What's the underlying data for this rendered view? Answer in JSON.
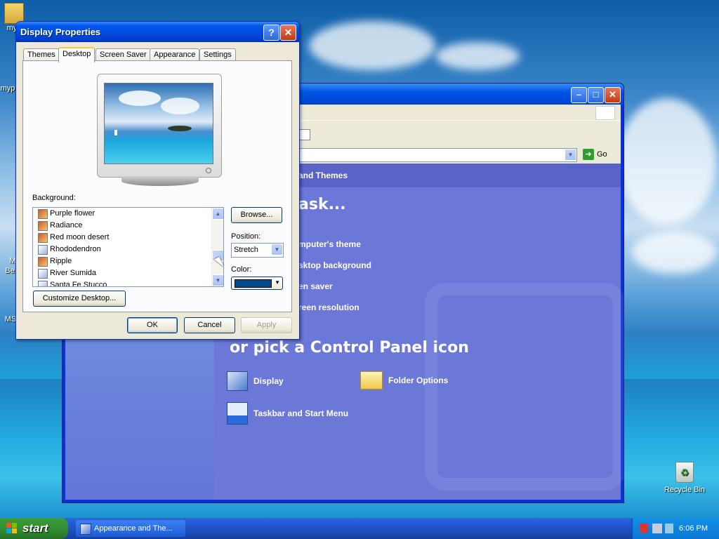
{
  "desktop": {
    "icons": [
      {
        "label": "myp"
      },
      {
        "label": "myp"
      },
      {
        "label": "M"
      },
      {
        "label": "Be"
      },
      {
        "label": "MS"
      },
      {
        "label": "Recycle Bin"
      }
    ]
  },
  "control_panel": {
    "go_label": "Go",
    "breadcrumb": "and Themes",
    "task_heading": "ask...",
    "tasks": [
      "mputer's theme",
      "sktop background",
      "en saver",
      "reen resolution"
    ],
    "icon_heading": "or pick a Control Panel icon",
    "icons": [
      {
        "label": "Display",
        "icon": "display-icon"
      },
      {
        "label": "Folder Options",
        "icon": "folder-options-icon"
      },
      {
        "label": "Taskbar and Start Menu",
        "icon": "taskbar-icon"
      }
    ]
  },
  "dialog": {
    "title": "Display Properties",
    "help_label": "?",
    "close_label": "✕",
    "tabs": [
      "Themes",
      "Desktop",
      "Screen Saver",
      "Appearance",
      "Settings"
    ],
    "active_tab": "Desktop",
    "background_label": "Background:",
    "backgrounds": [
      {
        "name": "Purple flower",
        "icon": "image-file-icon"
      },
      {
        "name": "Radiance",
        "icon": "image-file-icon"
      },
      {
        "name": "Red moon desert",
        "icon": "image-file-icon"
      },
      {
        "name": "Rhododendron",
        "icon": "bitmap-file-icon"
      },
      {
        "name": "Ripple",
        "icon": "image-file-icon"
      },
      {
        "name": "River Sumida",
        "icon": "bitmap-file-icon"
      },
      {
        "name": "Santa Fe Stucco",
        "icon": "bitmap-file-icon"
      }
    ],
    "browse_label": "Browse...",
    "position_label": "Position:",
    "position_value": "Stretch",
    "color_label": "Color:",
    "color_value": "#00498c",
    "customize_label": "Customize Desktop...",
    "ok_label": "OK",
    "cancel_label": "Cancel",
    "apply_label": "Apply"
  },
  "taskbar": {
    "start_label": "start",
    "tasks": [
      {
        "label": "Appearance and The..."
      }
    ],
    "clock": "6:06 PM"
  }
}
